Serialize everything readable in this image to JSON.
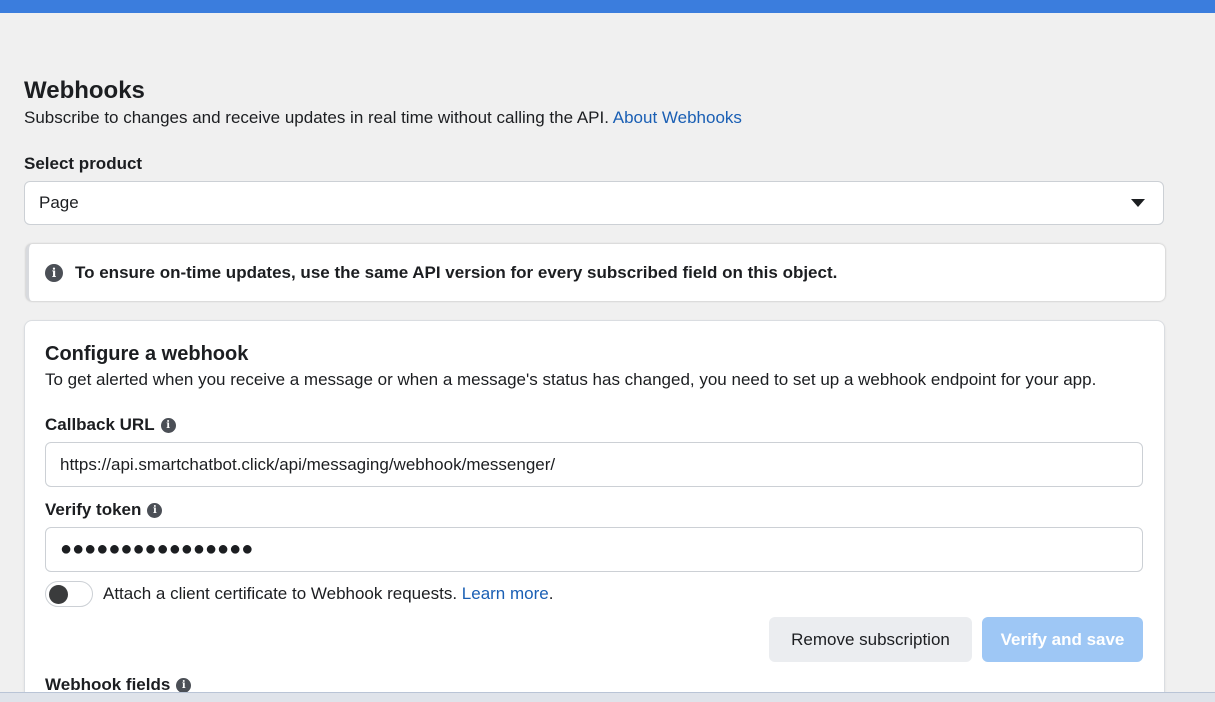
{
  "colors": {
    "accent": "#3b7ddd",
    "link": "#1a5fb4",
    "primary_button_disabled": "#9ec7f5"
  },
  "header": {
    "title": "Webhooks",
    "subtitle": "Subscribe to changes and receive updates in real time without calling the API.",
    "about_link": "About Webhooks"
  },
  "product": {
    "label": "Select product",
    "selected": "Page",
    "caret_icon": "caret-down-icon"
  },
  "notice": {
    "icon": "info-icon",
    "text": "To ensure on-time updates, use the same API version for every subscribed field on this object."
  },
  "configure": {
    "title": "Configure a webhook",
    "description": "To get alerted when you receive a message or when a message's status has changed, you need to set up a webhook endpoint for your app.",
    "callback_label": "Callback URL",
    "callback_value": "https://api.smartchatbot.click/api/messaging/webhook/messenger/",
    "verify_label": "Verify token",
    "verify_value": "●●●●●●●●●●●●●●●●",
    "toggle_text": "Attach a client certificate to Webhook requests.",
    "learn_more": "Learn more",
    "toggle_period": ".",
    "toggle_on": false,
    "remove_button": "Remove subscription",
    "verify_button": "Verify and save",
    "fields_label": "Webhook fields",
    "info_glyph": "i"
  }
}
